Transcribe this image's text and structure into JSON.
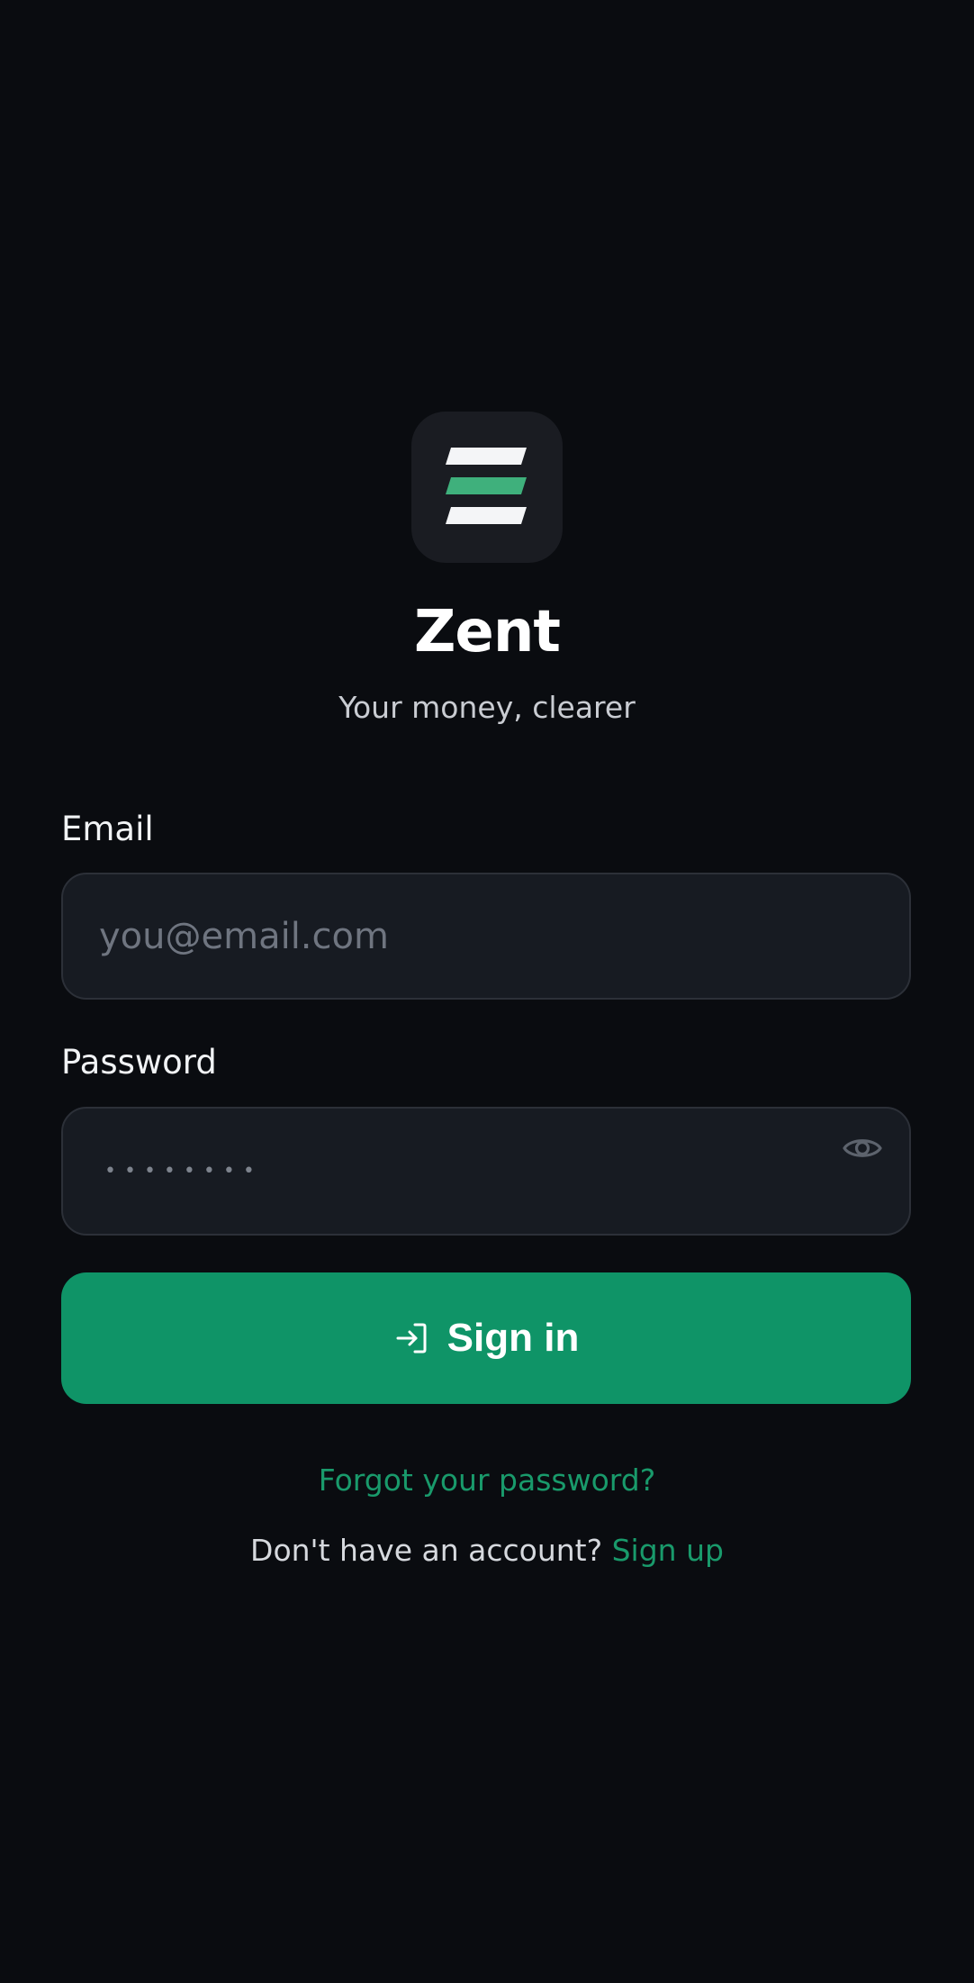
{
  "brand": {
    "logo_icon": "stacked-bars-logo-icon",
    "app_name": "Zent",
    "tagline": "Your money, clearer"
  },
  "form": {
    "email": {
      "label": "Email",
      "value": "",
      "placeholder": "you@email.com"
    },
    "password": {
      "label": "Password",
      "masked_value": "••••••••",
      "toggle_icon": "eye-icon"
    },
    "submit": {
      "icon": "sign-in-arrow-icon",
      "label": "Sign in"
    }
  },
  "links": {
    "forgot_password": "Forgot your password?",
    "signup_prompt": "Don't have an account?",
    "signup": "Sign up"
  },
  "colors": {
    "background": "#0a0c10",
    "accent": "#0f9467",
    "link": "#199a6b",
    "input_bg": "#171b22"
  }
}
